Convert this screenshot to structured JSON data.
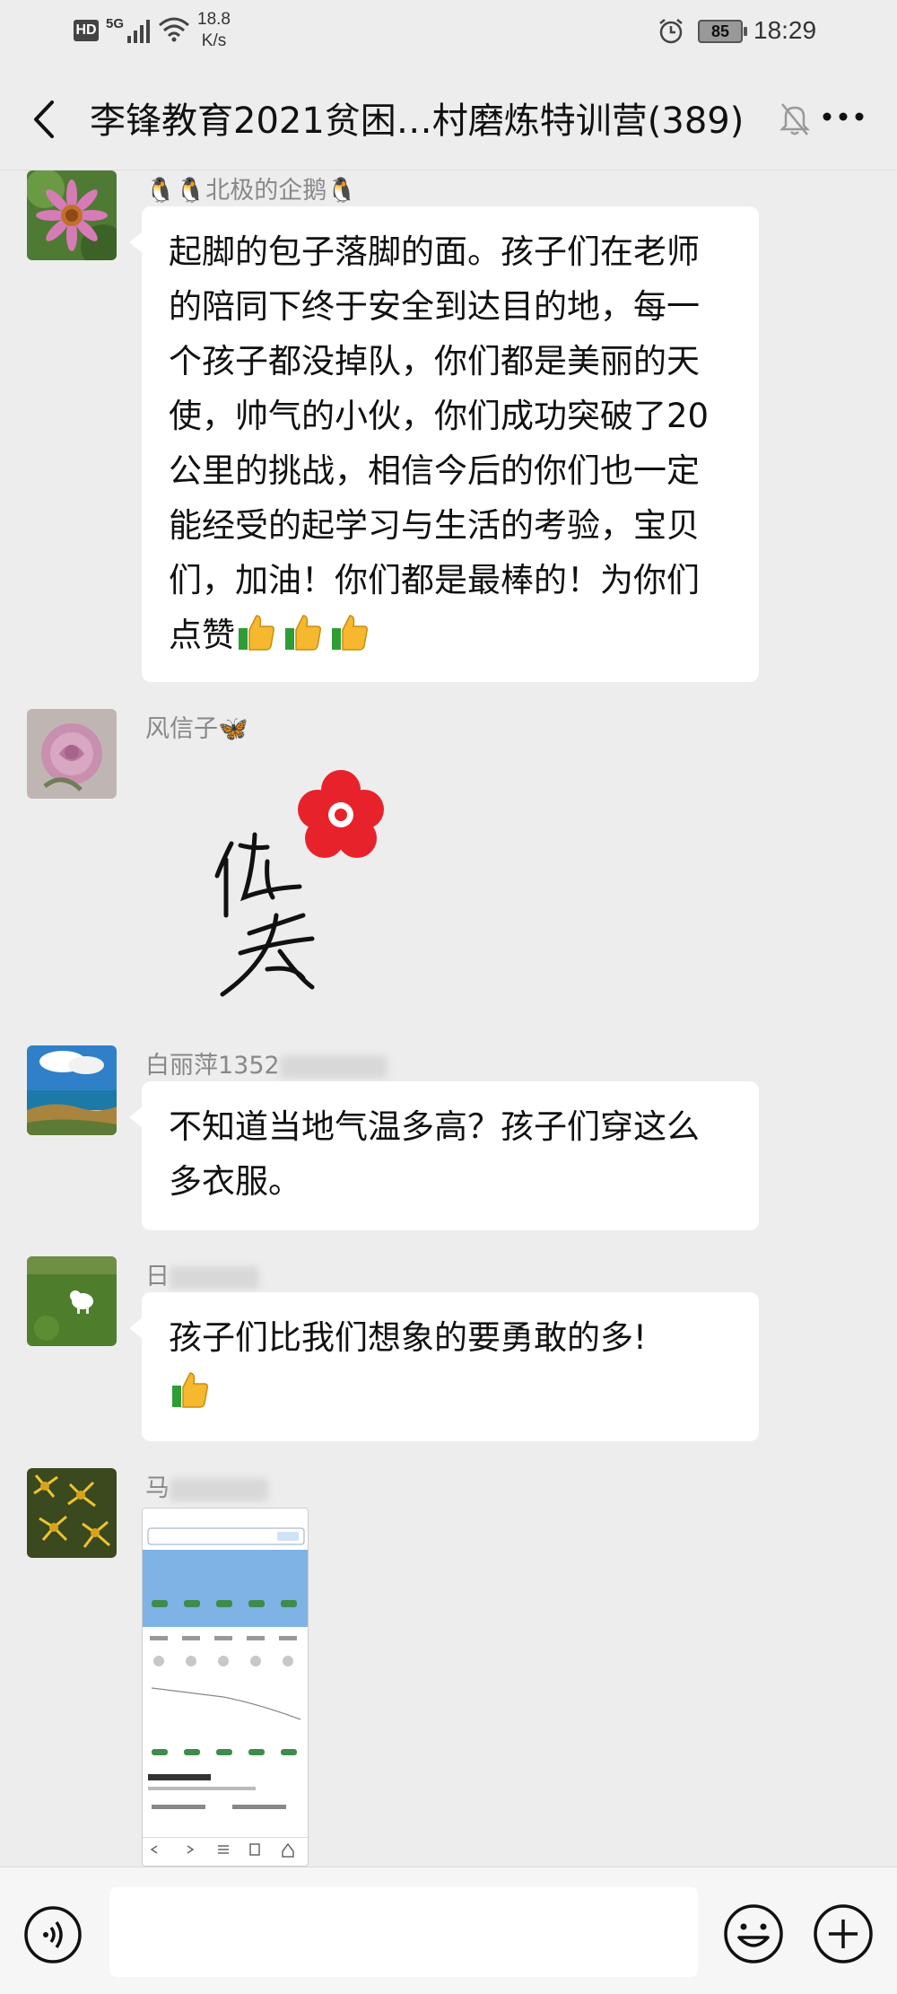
{
  "status_bar": {
    "hd": "HD",
    "network": "5G",
    "speed_value": "18.8",
    "speed_unit": "K/s",
    "battery": "85",
    "time": "18:29"
  },
  "header": {
    "title": "李锋教育2021贫困…村磨炼特训营(389)"
  },
  "messages": [
    {
      "sender": "北极的企鹅",
      "text": "起脚的包子落脚的面。孩子们在老师的陪同下终于安全到达目的地，每一个孩子都没掉队，你们都是美丽的天使，帅气的小伙，你们成功突破了20公里的挑战，相信今后的你们也一定能经受的起学习与生活的考验，宝贝们，加油！你们都是最棒的！为你们点赞"
    },
    {
      "sender": "风信子",
      "sticker_text": "优秀"
    },
    {
      "sender": "白丽萍1352",
      "text": "不知道当地气温多高？孩子们穿这么多衣服。"
    },
    {
      "sender": "日",
      "text": "孩子们比我们想象的要勇敢的多!"
    },
    {
      "sender": "马",
      "image": "weather-screenshot-thumbnail"
    }
  ],
  "icons": {
    "back": "chevron-left-icon",
    "mute": "bell-muted-icon",
    "more": "more-dots-icon",
    "voice": "voice-icon",
    "emoji": "emoji-icon",
    "plus": "plus-icon",
    "thumbs_up": "thumbs-up-emoji"
  },
  "colors": {
    "background": "#ededed",
    "bubble": "#ffffff",
    "sticker_flower": "#e8222b"
  }
}
